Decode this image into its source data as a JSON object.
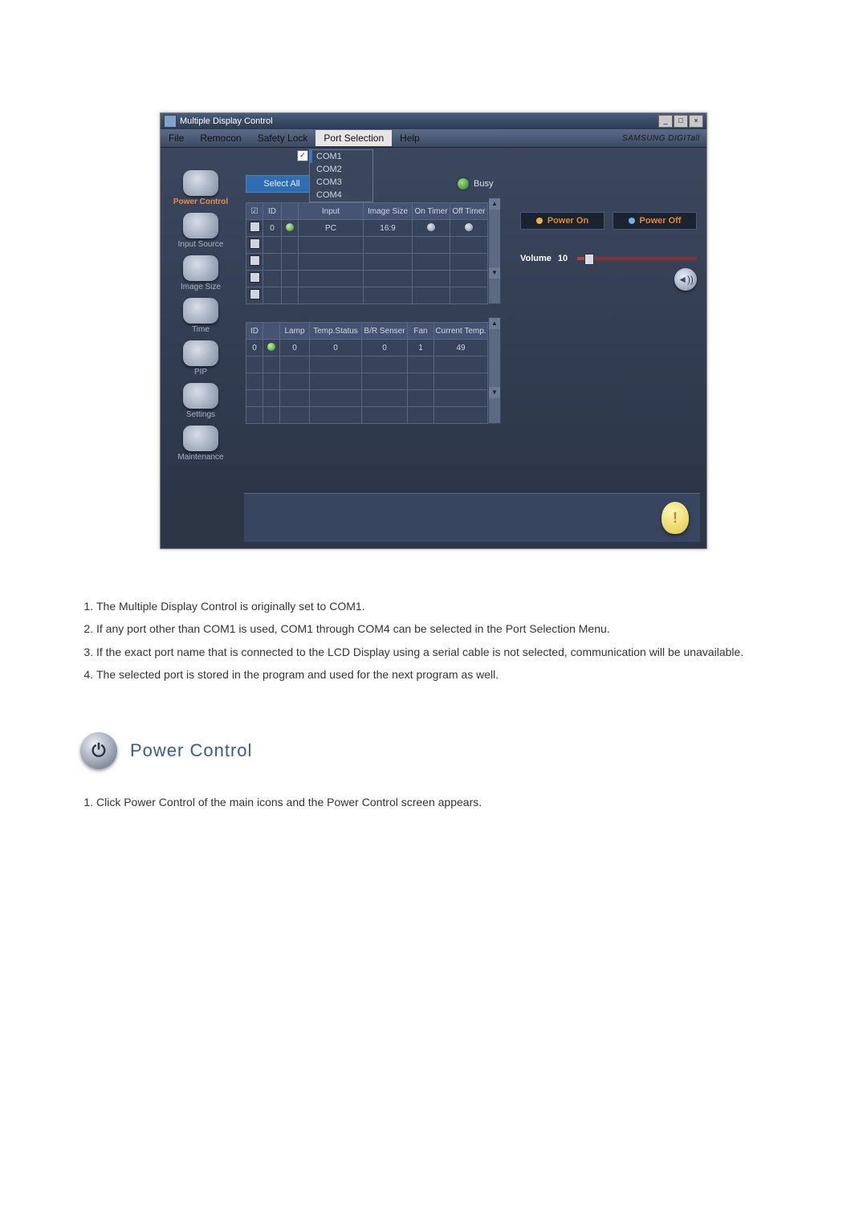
{
  "window": {
    "title": "Multiple Display Control",
    "win_min": "_",
    "win_max": "□",
    "win_close": "×"
  },
  "menu": {
    "file": "File",
    "remocon": "Remocon",
    "safety": "Safety Lock",
    "port": "Port Selection",
    "help": "Help",
    "brand": "SAMSUNG DIGITall"
  },
  "ports": {
    "check": "✓",
    "com1": "COM1",
    "com2": "COM2",
    "com3": "COM3",
    "com4": "COM4"
  },
  "sidebar": {
    "power": "Power Control",
    "input": "Input Source",
    "image": "Image Size",
    "time": "Time",
    "pip": "PIP",
    "settings": "Settings",
    "maint": "Maintenance"
  },
  "controls": {
    "select_all": "Select All",
    "busy": "Busy"
  },
  "grid1": {
    "h_chk": "☑",
    "h_id": "ID",
    "h_stat": " ",
    "h_input": "Input",
    "h_img": "Image Size",
    "h_ont": "On Timer",
    "h_offt": "Off Timer",
    "r1_id": "0",
    "r1_input": "PC",
    "r1_img": "16:9"
  },
  "grid2": {
    "h_id": "ID",
    "h_stat": " ",
    "h_lamp": "Lamp",
    "h_temp": "Temp.Status",
    "h_br": "B/R Senser",
    "h_fan": "Fan",
    "h_cur": "Current Temp.",
    "r1_id": "0",
    "r1_lamp": "0",
    "r1_temp": "0",
    "r1_br": "0",
    "r1_fan": "1",
    "r1_cur": "49"
  },
  "right": {
    "power_on": "Power On",
    "power_off": "Power Off",
    "volume": "Volume",
    "volume_val": "10",
    "speaker": "◄))"
  },
  "info_icon": "!",
  "doc": {
    "li1": "The Multiple Display Control is originally set to COM1.",
    "li2": "If any port other than COM1 is used, COM1 through COM4 can be selected in the Port Selection Menu.",
    "li3": "If the exact port name that is connected to the LCD Display using a serial cable is not selected, communication will be unavailable.",
    "li4": "The selected port is stored in the program and used for the next program as well."
  },
  "section2": {
    "title": "Power Control",
    "li1": "Click Power Control of the main icons and the Power Control screen appears."
  }
}
